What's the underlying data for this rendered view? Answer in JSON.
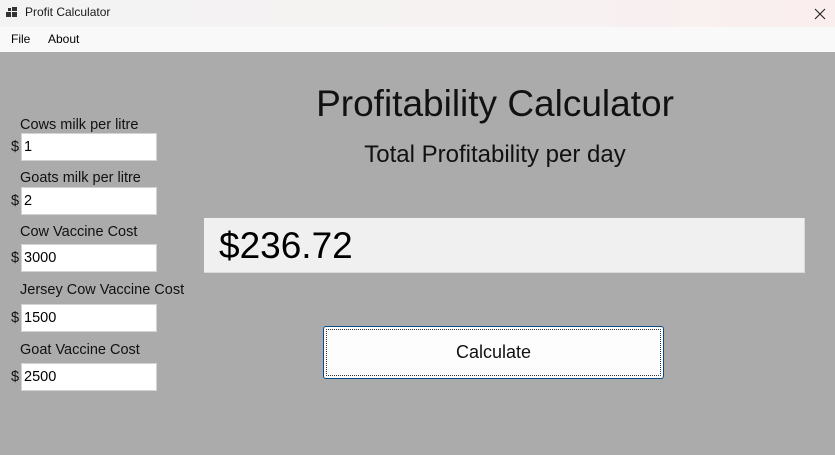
{
  "window": {
    "title": "Profit Calculator"
  },
  "menu": {
    "file": "File",
    "about": "About"
  },
  "fields": [
    {
      "label": "Cows milk per litre",
      "currency": "$",
      "value": "1"
    },
    {
      "label": "Goats milk per litre",
      "currency": "$",
      "value": "2"
    },
    {
      "label": "Cow Vaccine Cost",
      "currency": "$",
      "value": "3000"
    },
    {
      "label": "Jersey Cow Vaccine Cost",
      "currency": "$",
      "value": "1500"
    },
    {
      "label": "Goat Vaccine Cost",
      "currency": "$",
      "value": "2500"
    }
  ],
  "main": {
    "title": "Profitability Calculator",
    "subtitle": "Total Profitability per day",
    "result": "$236.72",
    "calculate_label": "Calculate"
  },
  "icons": {
    "app": "app-grid-icon",
    "close": "close-icon"
  },
  "colors": {
    "background": "#ababab",
    "result_box": "#f0f0f0",
    "button_border": "#0a4c8a"
  }
}
